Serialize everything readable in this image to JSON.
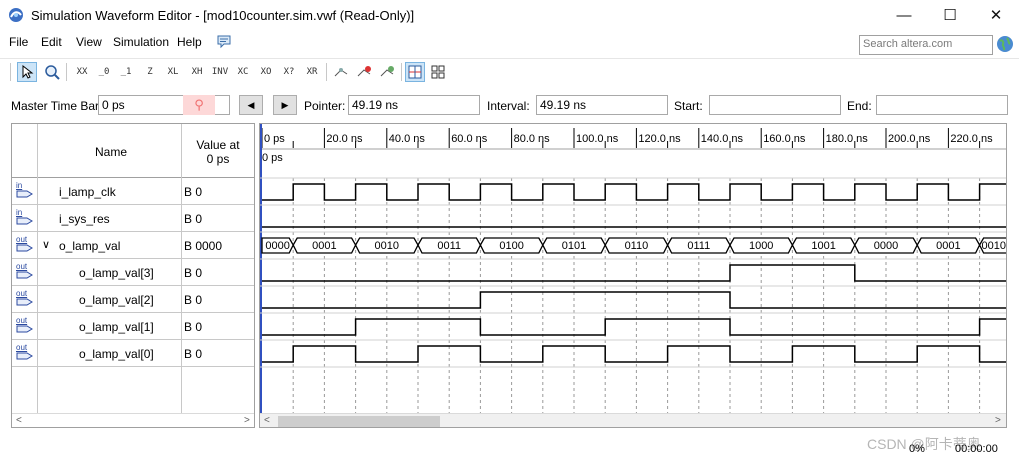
{
  "window": {
    "title": "Simulation Waveform Editor - [mod10counter.sim.vwf (Read-Only)]",
    "minimize": "—",
    "maximize": "☐",
    "close": "✕"
  },
  "menu": {
    "file": "File",
    "edit": "Edit",
    "view": "View",
    "simulation": "Simulation",
    "help": "Help"
  },
  "search": {
    "placeholder": "Search altera.com"
  },
  "toolbar": {
    "icons": [
      "select-tool-icon",
      "zoom-tool-icon",
      "forcing-unknown-icon",
      "forcing-low-icon",
      "forcing-high-icon",
      "high-impedance-icon",
      "weak-low-icon",
      "weak-high-icon",
      "invert-icon",
      "count-value-icon",
      "clock-value-icon",
      "arbitrary-value-icon",
      "random-value-icon",
      "snap-grid-icon",
      "run-functional-icon",
      "run-timing-icon",
      "generate-netlist-icon",
      "grid-size-icon",
      "group-icon"
    ]
  },
  "timebar": {
    "master_label": "Master Time Bar:",
    "master_value": "0 ps",
    "pointer_label": "Pointer:",
    "pointer_value": "49.19 ns",
    "interval_label": "Interval:",
    "interval_value": "49.19 ns",
    "start_label": "Start:",
    "start_value": "",
    "end_label": "End:",
    "end_value": ""
  },
  "columns": {
    "name": "Name",
    "value_line1": "Value at",
    "value_line2": "0 ps"
  },
  "signals": [
    {
      "dir": "in",
      "name": "i_lamp_clk",
      "value": "B 0",
      "indent": 0
    },
    {
      "dir": "in",
      "name": "i_sys_res",
      "value": "B 0",
      "indent": 0
    },
    {
      "dir": "out",
      "name": "o_lamp_val",
      "value": "B 0000",
      "indent": 0,
      "expanded": true
    },
    {
      "dir": "out",
      "name": "o_lamp_val[3]",
      "value": "B 0",
      "indent": 1
    },
    {
      "dir": "out",
      "name": "o_lamp_val[2]",
      "value": "B 0",
      "indent": 1
    },
    {
      "dir": "out",
      "name": "o_lamp_val[1]",
      "value": "B 0",
      "indent": 1
    },
    {
      "dir": "out",
      "name": "o_lamp_val[0]",
      "value": "B 0",
      "indent": 1
    }
  ],
  "timeline": {
    "ticks": [
      "0 ps",
      "20.0 ns",
      "40.0 ns",
      "60.0 ns",
      "80.0 ns",
      "100.0 ns",
      "120.0 ns",
      "140.0 ns",
      "160.0 ns",
      "180.0 ns",
      "200.0 ns",
      "220.0 ns"
    ],
    "cursor_label": "0 ps",
    "ns_per_tick": 20
  },
  "waves": {
    "clk_period_ns": 20,
    "clk_first_rise_ns": 10,
    "bus_values": [
      "0000",
      "0001",
      "0010",
      "0011",
      "0100",
      "0101",
      "0110",
      "0111",
      "1000",
      "1001",
      "0000",
      "0001",
      "0010"
    ],
    "bus_change_ns": [
      10,
      30,
      50,
      70,
      90,
      110,
      130,
      150,
      170,
      190,
      210,
      230
    ],
    "bit3": [
      [
        0,
        0
      ],
      [
        150,
        1
      ],
      [
        190,
        0
      ]
    ],
    "bit2": [
      [
        0,
        0
      ],
      [
        70,
        1
      ],
      [
        150,
        0
      ]
    ],
    "bit1": [
      [
        0,
        0
      ],
      [
        30,
        1
      ],
      [
        70,
        0
      ],
      [
        110,
        1
      ],
      [
        150,
        0
      ],
      [
        230,
        1
      ]
    ],
    "bit0": [
      [
        0,
        0
      ],
      [
        10,
        1
      ],
      [
        30,
        0
      ],
      [
        50,
        1
      ],
      [
        70,
        0
      ],
      [
        90,
        1
      ],
      [
        110,
        0
      ],
      [
        130,
        1
      ],
      [
        150,
        0
      ],
      [
        170,
        1
      ],
      [
        190,
        0
      ],
      [
        210,
        1
      ],
      [
        230,
        0
      ]
    ],
    "res": [
      [
        0,
        0
      ]
    ]
  },
  "status": {
    "percent": "0%",
    "elapsed": "00:00:00"
  },
  "watermark": "CSDN @阿卡蒂奥"
}
